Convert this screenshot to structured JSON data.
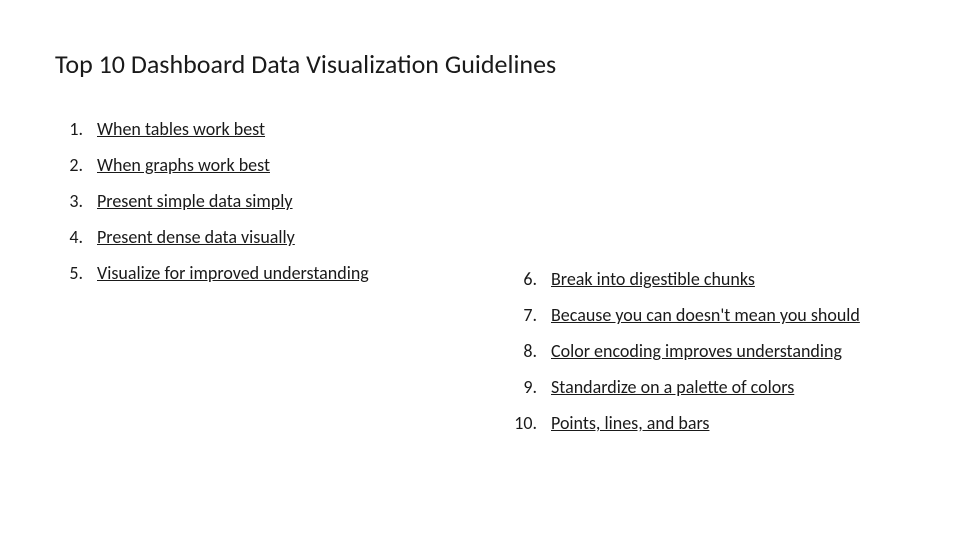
{
  "title": "Top 10 Dashboard Data Visualization Guidelines",
  "left_list": [
    {
      "num": "1.",
      "text": "When tables work best"
    },
    {
      "num": "2.",
      "text": "When graphs work best"
    },
    {
      "num": "3.",
      "text": "Present simple data simply"
    },
    {
      "num": "4.",
      "text": "Present dense data visually"
    },
    {
      "num": "5.",
      "text": "Visualize for improved understanding"
    }
  ],
  "right_list": [
    {
      "num": "6.",
      "text": "Break into digestible chunks"
    },
    {
      "num": "7.",
      "text": "Because you can doesn't mean you should"
    },
    {
      "num": "8.",
      "text": "Color encoding improves understanding"
    },
    {
      "num": "9.",
      "text": "Standardize on a palette of colors"
    },
    {
      "num": "10.",
      "text": "Points, lines, and bars"
    }
  ]
}
